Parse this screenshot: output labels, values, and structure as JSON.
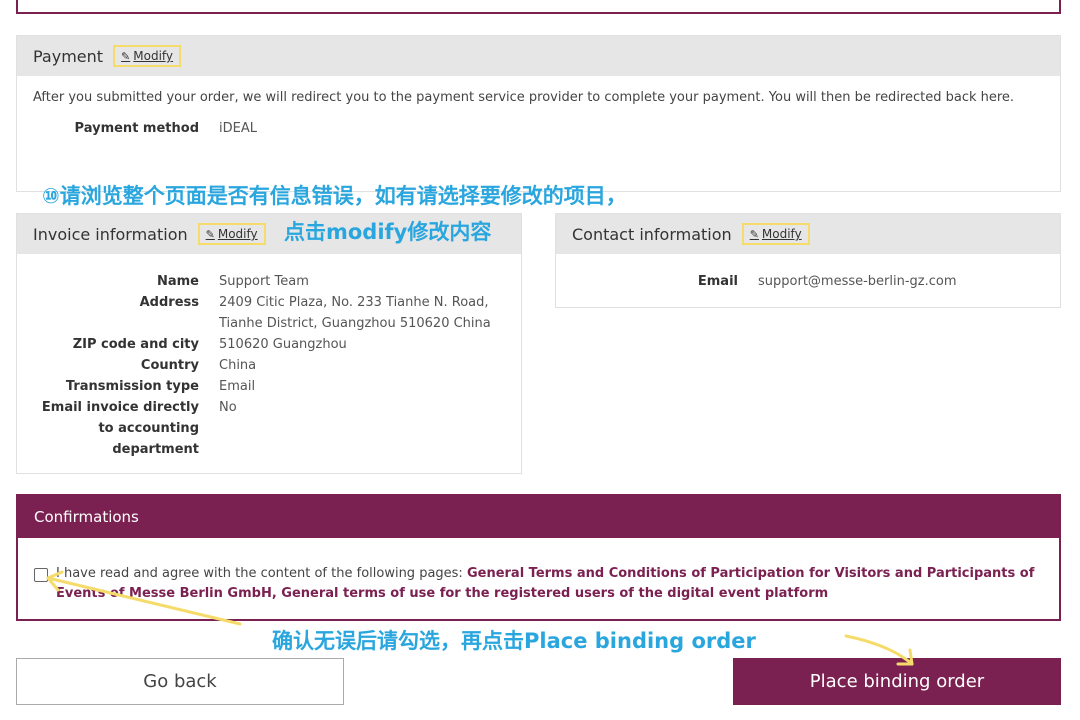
{
  "payment": {
    "title": "Payment",
    "modify_label": "Modify",
    "description": "After you submitted your order, we will redirect you to the payment service provider to complete your payment. You will then be redirected back here.",
    "method_label": "Payment method",
    "method_value": "iDEAL"
  },
  "invoice": {
    "title": "Invoice information",
    "modify_label": "Modify",
    "rows": [
      {
        "label": "Name",
        "value": "Support Team"
      },
      {
        "label": "Address",
        "value": "2409 Citic Plaza, No. 233 Tianhe N. Road, Tianhe District, Guangzhou 510620 China"
      },
      {
        "label": "ZIP code and city",
        "value": "510620 Guangzhou"
      },
      {
        "label": "Country",
        "value": "China"
      },
      {
        "label": "Transmission type",
        "value": "Email"
      },
      {
        "label": "Email invoice directly to accounting department",
        "value": "No"
      }
    ]
  },
  "contact": {
    "title": "Contact information",
    "modify_label": "Modify",
    "email_label": "Email",
    "email_value": "support@messe-berlin-gz.com"
  },
  "confirmations": {
    "title": "Confirmations",
    "text_prefix": "I have read and agree with the content of the following pages: ",
    "link1": "General Terms and Conditions of Participation for Visitors and Participants of Events of Messe Berlin GmbH",
    "separator": ", ",
    "link2": "General terms of use for the registered users of the digital event platform"
  },
  "buttons": {
    "back_label": "Go back",
    "place_label": "Place binding order"
  },
  "annotations": {
    "line1": "⑩请浏览整个页面是否有信息错误，如有请选择要修改的项目，",
    "line2": "点击modify修改内容",
    "line3": "确认无误后请勾选，再点击Place binding order",
    "color": "#2aa6de",
    "arrow_color": "#f5dc6a"
  },
  "colors": {
    "brand": "#7b2151",
    "panel_header": "#e6e6e6",
    "highlight_box": "#f5dc6a"
  }
}
